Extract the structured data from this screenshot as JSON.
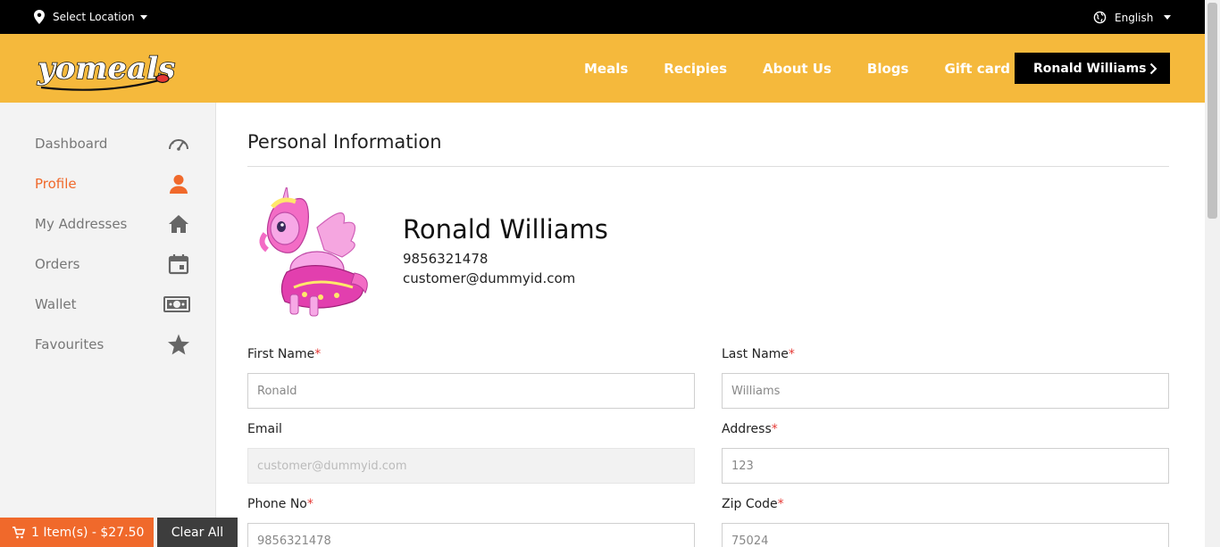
{
  "topbar": {
    "location_label": "Select Location",
    "language": "English"
  },
  "header": {
    "logo_text": "yomeals",
    "nav": [
      "Meals",
      "Recipies",
      "About Us",
      "Blogs",
      "Gift card"
    ],
    "user_button": "Ronald Williams"
  },
  "sidebar": {
    "items": [
      {
        "label": "Dashboard",
        "icon": "speedometer-icon"
      },
      {
        "label": "Profile",
        "icon": "person-icon",
        "active": true
      },
      {
        "label": "My Addresses",
        "icon": "home-icon"
      },
      {
        "label": "Orders",
        "icon": "calendar-icon"
      },
      {
        "label": "Wallet",
        "icon": "money-icon"
      },
      {
        "label": "Favourites",
        "icon": "star-icon"
      }
    ]
  },
  "main": {
    "title": "Personal Information",
    "profile": {
      "name": "Ronald Williams",
      "phone": "9856321478",
      "email": "customer@dummyid.com"
    },
    "form": {
      "first_name": {
        "label": "First Name",
        "required": "*",
        "value": "Ronald"
      },
      "last_name": {
        "label": "Last Name",
        "required": "*",
        "value": "Williams"
      },
      "email": {
        "label": "Email",
        "value": "customer@dummyid.com"
      },
      "address": {
        "label": "Address",
        "required": "*",
        "value": "123"
      },
      "phone": {
        "label": "Phone No",
        "required": "*",
        "value": "9856321478"
      },
      "zip": {
        "label": "Zip Code",
        "required": "*",
        "value": "75024"
      }
    }
  },
  "cart": {
    "summary": "1 Item(s) - $27.50",
    "clear_label": "Clear All"
  },
  "colors": {
    "brand": "#f5b93c",
    "accent": "#f0692b",
    "topbar": "#000000"
  }
}
